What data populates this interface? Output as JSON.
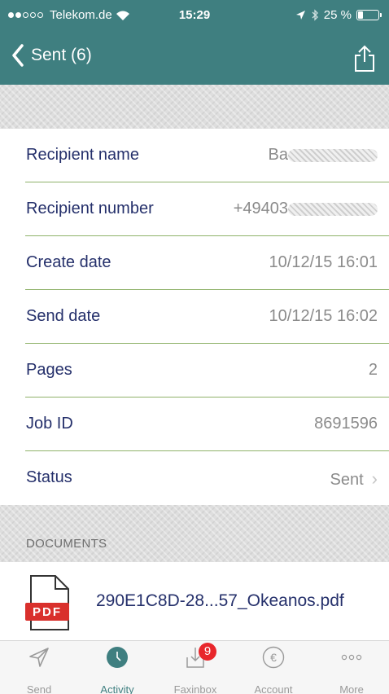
{
  "status_bar": {
    "carrier": "Telekom.de",
    "time": "15:29",
    "battery": "25 %",
    "battery_level": 0.25,
    "signal_bars_filled": 2,
    "signal_bars_total": 5
  },
  "nav": {
    "back_label": "Sent (6)"
  },
  "details": [
    {
      "label": "Recipient name",
      "value": "Ba",
      "redacted": true
    },
    {
      "label": "Recipient number",
      "value": "+49403",
      "redacted": true
    },
    {
      "label": "Create date",
      "value": "10/12/15 16:01"
    },
    {
      "label": "Send date",
      "value": "10/12/15 16:02"
    },
    {
      "label": "Pages",
      "value": "2"
    },
    {
      "label": "Job ID",
      "value": "8691596"
    },
    {
      "label": "Status",
      "value": "Sent",
      "disclosure": true
    }
  ],
  "documents": {
    "section_title": "DOCUMENTS",
    "items": [
      {
        "name": "290E1C8D-28...57_Okeanos.pdf",
        "icon": "pdf-file-icon",
        "icon_text": "PDF"
      }
    ]
  },
  "tabbar": [
    {
      "label": "Send",
      "icon": "paper-plane-icon"
    },
    {
      "label": "Activity",
      "icon": "clock-icon",
      "active": true
    },
    {
      "label": "Faxinbox",
      "icon": "inbox-download-icon",
      "badge": "9"
    },
    {
      "label": "Account",
      "icon": "euro-icon"
    },
    {
      "label": "More",
      "icon": "more-dots-icon"
    }
  ],
  "colors": {
    "nav_bg": "#3f7f80",
    "label_text": "#25306b",
    "separator": "#8fb26a",
    "badge": "#e8262b",
    "pdf_red": "#d9302c"
  }
}
